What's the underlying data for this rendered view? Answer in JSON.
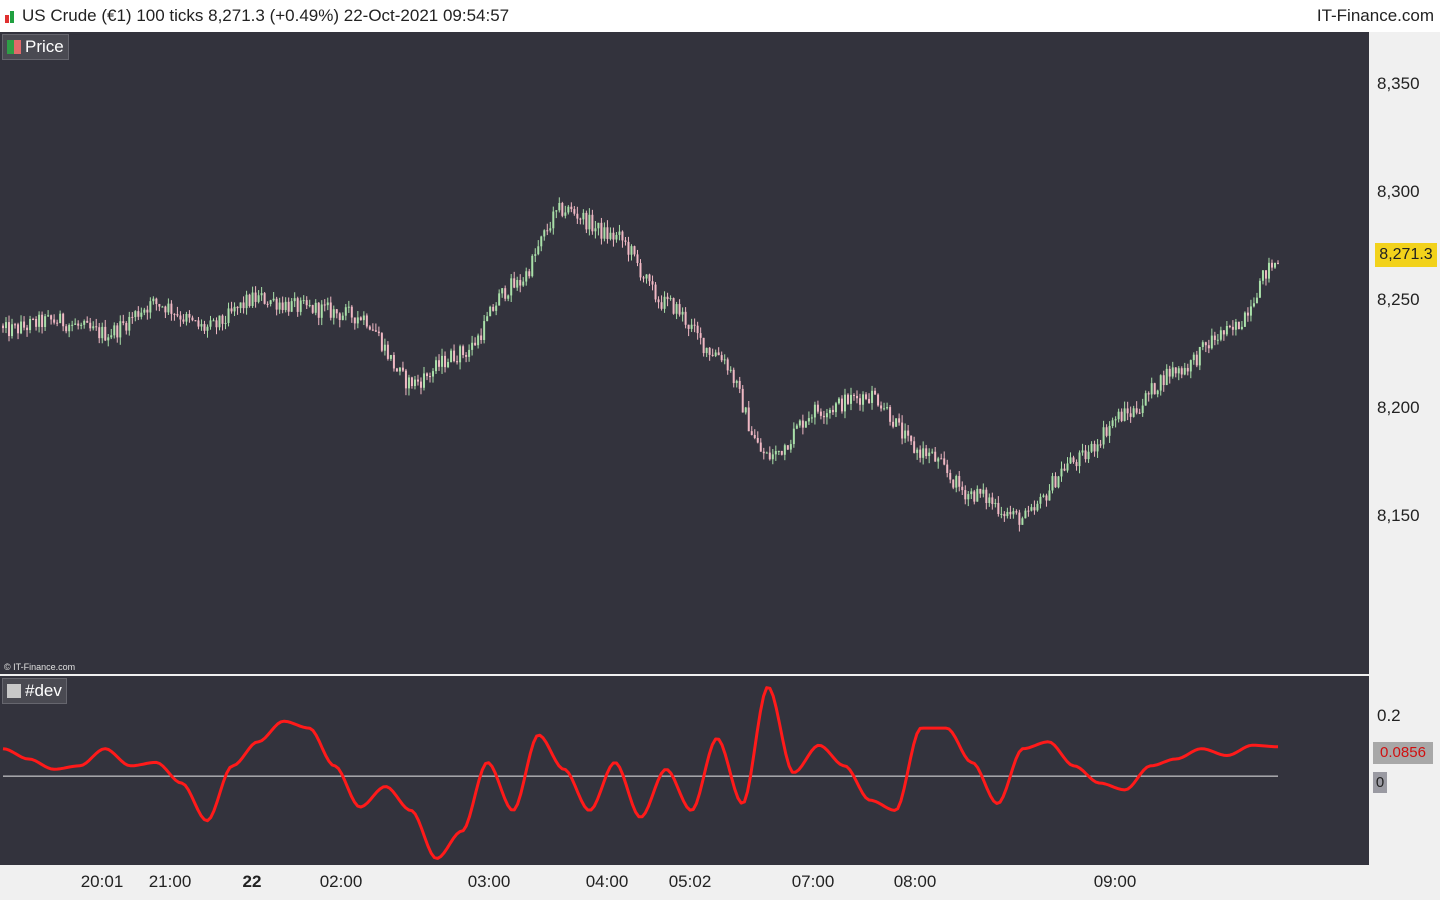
{
  "header": {
    "title": "US Crude (€1) 100 ticks 8,271.3 (+0.49%) 22-Oct-2021 09:54:57",
    "brand": "IT-Finance.com"
  },
  "panes": {
    "price": {
      "label": "Price"
    },
    "dev": {
      "label": "#dev"
    },
    "copyright": "© IT-Finance.com"
  },
  "colors": {
    "background": "#33333d",
    "up_candle": "#a9e0a9",
    "down_candle": "#f0b8c4",
    "dev_line": "#ff1a1a",
    "zero_line": "#e8e8e8",
    "price_tag": "#f2d21b"
  },
  "chart_data": [
    {
      "type": "line",
      "pane": "price",
      "series": [
        {
          "name": "Price"
        }
      ],
      "x_tick_labels": [
        "20:01",
        "21:00",
        "22",
        "02:00",
        "03:00",
        "04:00",
        "05:02",
        "07:00",
        "08:00",
        "09:00"
      ],
      "y_tick_labels": [
        "8,350",
        "8,300",
        "8,250",
        "8,200",
        "8,150"
      ],
      "ylim": [
        8105,
        8365
      ],
      "last_value": 8271.3,
      "last_value_label": "8,271.3",
      "x": [
        0,
        4,
        8,
        12,
        16,
        20,
        24,
        28,
        32,
        36,
        40,
        44,
        48,
        52,
        56,
        60,
        64,
        68,
        72,
        76,
        80,
        84,
        88,
        92,
        96,
        100
      ],
      "values": [
        8244,
        8248,
        8243,
        8255,
        8245,
        8257,
        8253,
        8250,
        8223,
        8235,
        8262,
        8293,
        8282,
        8255,
        8235,
        8193,
        8212,
        8218,
        8195,
        8178,
        8168,
        8191,
        8210,
        8228,
        8243,
        8271.3
      ]
    },
    {
      "type": "line",
      "pane": "dev",
      "series": [
        {
          "name": "#dev"
        }
      ],
      "y_tick_labels": [
        "0.2",
        "0"
      ],
      "ylim": [
        -0.25,
        0.28
      ],
      "last_value": 0.0856,
      "last_value_label": "0.0856",
      "x": [
        0,
        2,
        4,
        6,
        8,
        10,
        12,
        14,
        16,
        18,
        20,
        22,
        24,
        26,
        28,
        30,
        32,
        34,
        36,
        38,
        40,
        42,
        44,
        46,
        48,
        50,
        52,
        54,
        56,
        58,
        60,
        62,
        64,
        66,
        68,
        70,
        72,
        74,
        76,
        78,
        80,
        82,
        84,
        86,
        88,
        90,
        92,
        94,
        96,
        98,
        100
      ],
      "values": [
        0.08,
        0.05,
        0.02,
        0.03,
        0.08,
        0.03,
        0.04,
        -0.02,
        -0.13,
        0.03,
        0.1,
        0.16,
        0.14,
        0.03,
        -0.09,
        -0.03,
        -0.1,
        -0.24,
        -0.16,
        0.04,
        -0.1,
        0.12,
        0.02,
        -0.1,
        0.04,
        -0.12,
        0.02,
        -0.1,
        0.11,
        -0.08,
        0.26,
        0.01,
        0.09,
        0.03,
        -0.07,
        -0.1,
        0.14,
        0.14,
        0.04,
        -0.08,
        0.08,
        0.1,
        0.03,
        -0.02,
        -0.04,
        0.03,
        0.05,
        0.08,
        0.06,
        0.09,
        0.0856
      ]
    }
  ]
}
